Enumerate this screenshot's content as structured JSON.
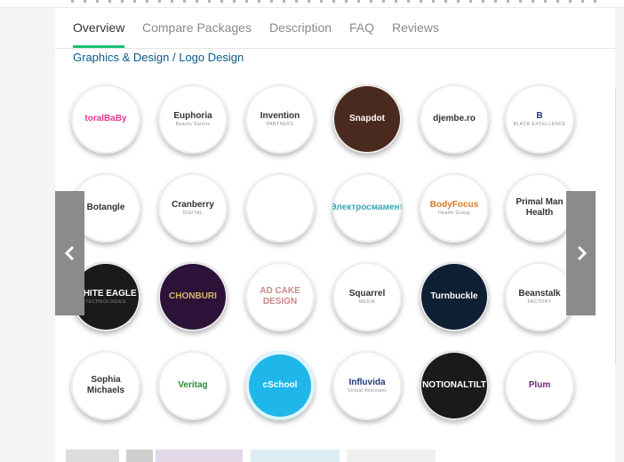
{
  "tabs": [
    {
      "label": "Overview"
    },
    {
      "label": "Compare Packages"
    },
    {
      "label": "Description"
    },
    {
      "label": "FAQ"
    },
    {
      "label": "Reviews"
    }
  ],
  "breadcrumb": "Graphics & Design / Logo Design",
  "gallery": {
    "logos": [
      {
        "name": "toralBaBy",
        "sub": "",
        "style": "",
        "color": "#e83a8f"
      },
      {
        "name": "Euphoria",
        "sub": "Beauty Salons",
        "style": "",
        "color": "#333"
      },
      {
        "name": "Invention",
        "sub": "PARTNERS",
        "style": "",
        "color": "#333"
      },
      {
        "name": "Snapdot",
        "sub": "",
        "style": "brown",
        "color": "#fff"
      },
      {
        "name": "djembe.ro",
        "sub": "",
        "style": "",
        "color": "#333"
      },
      {
        "name": "B",
        "sub": "BLACK EXCELLENCE",
        "style": "",
        "color": "#1f3a7a"
      },
      {
        "name": "Botangle",
        "sub": "",
        "style": "",
        "color": "#333"
      },
      {
        "name": "Cranberry",
        "sub": "DIGITAL",
        "style": "",
        "color": "#333"
      },
      {
        "name": "",
        "sub": "",
        "style": "",
        "color": "#333"
      },
      {
        "name": "Электросмамент",
        "sub": "",
        "style": "",
        "color": "#3aa7b8"
      },
      {
        "name": "BodyFocus",
        "sub": "Health Group",
        "style": "",
        "color": "#d77a2a"
      },
      {
        "name": "Primal Man Health",
        "sub": "",
        "style": "",
        "color": "#333"
      },
      {
        "name": "WHITE EAGLE",
        "sub": "TECHNOLOGIES",
        "style": "dark",
        "color": "#fff"
      },
      {
        "name": "CHONBURI",
        "sub": "",
        "style": "purple",
        "color": "#d9b56a"
      },
      {
        "name": "AD CAKE DESIGN",
        "sub": "",
        "style": "",
        "color": "#c98a8a"
      },
      {
        "name": "Squarrel",
        "sub": "MEDIA",
        "style": "",
        "color": "#333"
      },
      {
        "name": "Turnbuckle",
        "sub": "",
        "style": "navy",
        "color": "#fff"
      },
      {
        "name": "Beanstalk",
        "sub": "FACTORY",
        "style": "",
        "color": "#333"
      },
      {
        "name": "Sophia Michaels",
        "sub": "",
        "style": "",
        "color": "#333"
      },
      {
        "name": "Veritag",
        "sub": "",
        "style": "",
        "color": "#2f8a3a"
      },
      {
        "name": "cSchool",
        "sub": "",
        "style": "cyan",
        "color": "#fff"
      },
      {
        "name": "Influvida",
        "sub": "Virtual Assistant",
        "style": "",
        "color": "#1f3a7a"
      },
      {
        "name": "NOTIONALTILT",
        "sub": "",
        "style": "dark",
        "color": "#fff"
      },
      {
        "name": "Plum",
        "sub": "",
        "style": "",
        "color": "#6b2a6e"
      }
    ]
  },
  "controls": {
    "prev": "previous",
    "next": "next"
  }
}
